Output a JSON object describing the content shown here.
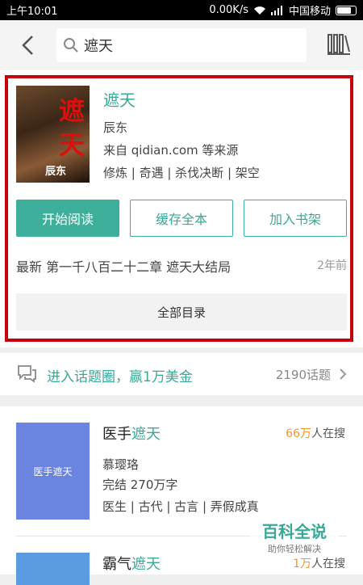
{
  "status": {
    "time": "上午10:01",
    "net_speed": "0.00K/s",
    "carrier": "中国移动"
  },
  "search": {
    "query": "遮天"
  },
  "book": {
    "title": "遮天",
    "cover_title_1": "遮",
    "cover_title_2": "天",
    "cover_author": "辰东",
    "author": "辰东",
    "source": "来自 qidian.com 等来源",
    "tags": "修炼 | 奇遇 | 杀伐决断 | 架空",
    "btn_read": "开始阅读",
    "btn_cache": "缓存全本",
    "btn_add": "加入书架",
    "latest": "最新  第一千八百二十二章 遮天大结局",
    "latest_ago": "2年前",
    "toc": "全部目录"
  },
  "topic": {
    "label": "进入话题圈，赢1万美金",
    "count": "2190话题"
  },
  "results": [
    {
      "cover_text": "医手遮天",
      "cover_color": "#6b84e0",
      "title_prefix": "医手",
      "title_hl": "遮天",
      "hot_num": "66万",
      "hot_suffix": "人在搜",
      "author": "慕璎珞",
      "info": "完结  270万字",
      "tags": "医生 | 古代 | 古言 | 弄假成真"
    },
    {
      "cover_text": "",
      "cover_color": "#5b9be0",
      "title_prefix": "霸气",
      "title_hl": "遮天",
      "hot_num": "1万",
      "hot_suffix": "人在搜"
    }
  ],
  "watermark": {
    "main": "百科全说",
    "sub": "助你轻松解决"
  },
  "colors": {
    "accent": "#3aa896",
    "highlight_frame": "#c4000b",
    "hot": "#f0962e"
  }
}
